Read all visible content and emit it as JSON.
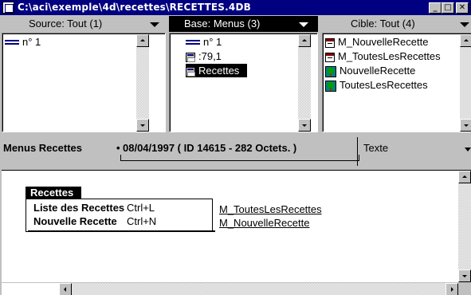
{
  "window": {
    "title": "C:\\aci\\exemple\\4d\\recettes\\RECETTES.4DB",
    "buttons": {
      "minimize": "_",
      "maximize": "□",
      "close": "✕"
    }
  },
  "headers": {
    "source": "Source: Tout (1)",
    "base": "Base: Menus (3)",
    "cible": "Cible: Tout (4)"
  },
  "source_pane": {
    "items": [
      {
        "icon": "dash-icon",
        "label": "n° 1"
      }
    ]
  },
  "base_pane": {
    "items": [
      {
        "icon": "dash-icon",
        "label": "n° 1"
      },
      {
        "icon": "menubar-icon",
        "label": ":79,1"
      },
      {
        "icon": "menubar-icon",
        "label": "Recettes",
        "selected": true
      }
    ]
  },
  "cible_pane": {
    "items": [
      {
        "icon": "menu-icon",
        "label": "M_NouvelleRecette"
      },
      {
        "icon": "menu-icon",
        "label": "M_ToutesLesRecettes"
      },
      {
        "icon": "tree-icon",
        "label": "NouvelleRecette"
      },
      {
        "icon": "tree-icon",
        "label": "ToutesLesRecettes"
      }
    ]
  },
  "info": {
    "menu_name": "Menus Recettes",
    "bullet": "•",
    "date_info": "08/04/1997 ( ID 14615 - 282 Octets. )",
    "type_label": "Texte"
  },
  "editor": {
    "menu_title": "Recettes",
    "items": [
      {
        "label": "Liste des Recettes",
        "shortcut": "Ctrl+L",
        "method": "M_ToutesLesRecettes"
      },
      {
        "label": "Nouvelle Recette",
        "shortcut": "Ctrl+N",
        "method": "M_NouvelleRecette"
      }
    ]
  }
}
